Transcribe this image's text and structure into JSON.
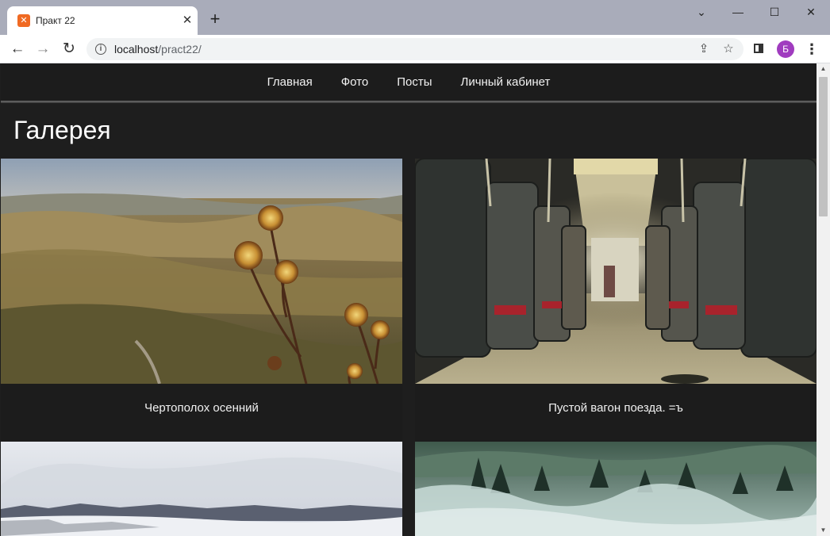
{
  "browser": {
    "tab_title": "Практ 22",
    "favicon_letter": "✕",
    "new_tab_symbol": "+",
    "url_host": "localhost",
    "url_path": "/pract22/",
    "avatar_letter": "Б",
    "window_controls": {
      "dropdown": "⌄",
      "minimize": "—",
      "maximize": "☐",
      "close": "✕"
    }
  },
  "site": {
    "nav": [
      {
        "label": "Главная"
      },
      {
        "label": "Фото"
      },
      {
        "label": "Посты"
      },
      {
        "label": "Личный кабинет"
      }
    ],
    "page_title": "Галерея",
    "gallery": [
      {
        "caption": "Чертополох осенний",
        "image": "thistle-mountains-photo"
      },
      {
        "caption": "Пустой вагон поезда. =ъ",
        "image": "empty-train-car-photo"
      },
      {
        "caption": "",
        "image": "snowy-forest-photo"
      },
      {
        "caption": "",
        "image": "misty-forest-photo"
      }
    ]
  },
  "colors": {
    "page_bg": "#1e1e1e",
    "nav_text": "#f2f2f2",
    "avatar_bg": "#a03cbf",
    "favicon_bg": "#f06a23"
  }
}
